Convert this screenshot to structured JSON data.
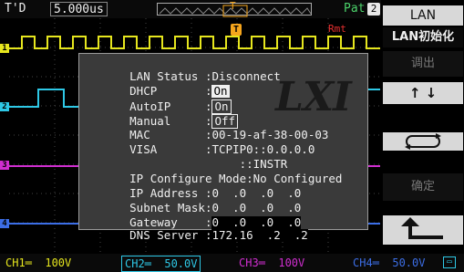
{
  "topbar": {
    "mode": "T'D",
    "timebase": "5.000us",
    "trigger_label": "T",
    "pattern": "Pat",
    "pattern_index": "2"
  },
  "plot": {
    "remote_label": "Rmt",
    "markers": {
      "ch1": "1",
      "ch2": "2",
      "ch3": "3",
      "ch4": "4"
    },
    "trigger_marker": "T"
  },
  "dialog": {
    "logo": "LXI",
    "rows": [
      {
        "label": "LAN Status :",
        "value": "Disconnect"
      },
      {
        "label": "DHCP       :",
        "value": "On"
      },
      {
        "label": "AutoIP     :",
        "value": "On"
      },
      {
        "label": "Manual     :",
        "value": "Off"
      },
      {
        "label": "MAC        :",
        "value": "00-19-af-38-00-03"
      },
      {
        "label": "VISA       :",
        "value": "TCPIP0::0.0.0.0"
      },
      {
        "label": "                ",
        "value": "::INSTR"
      },
      {
        "label": "IP Configure Mode:",
        "value": "No Configured"
      },
      {
        "label": "IP Address :",
        "value": "0  .0  .0  .0"
      },
      {
        "label": "Subnet Mask:",
        "value": "0  .0  .0  .0"
      },
      {
        "label": "Gateway    :",
        "value": "0  .0  .0  .0"
      },
      {
        "label": "DNS Server :",
        "value": "172.16  .2  .2"
      }
    ]
  },
  "softkeys": {
    "title": "LAN",
    "init": "LAN初始化",
    "apply": "调出",
    "arrows": "↑ ↓",
    "confirm": "确定"
  },
  "status_bar": {
    "ch1": "CH1═  100V",
    "ch2": "CH2═  50.0V",
    "ch3": "CH3═  100V",
    "ch4": "CH4═  50.0V"
  },
  "colors": {
    "ch1": "#e6e61e",
    "ch2": "#2ec8e6",
    "ch3": "#d02ed0",
    "ch4": "#3c6ee6",
    "trigger": "#f5a51c",
    "remote": "#e83030"
  }
}
